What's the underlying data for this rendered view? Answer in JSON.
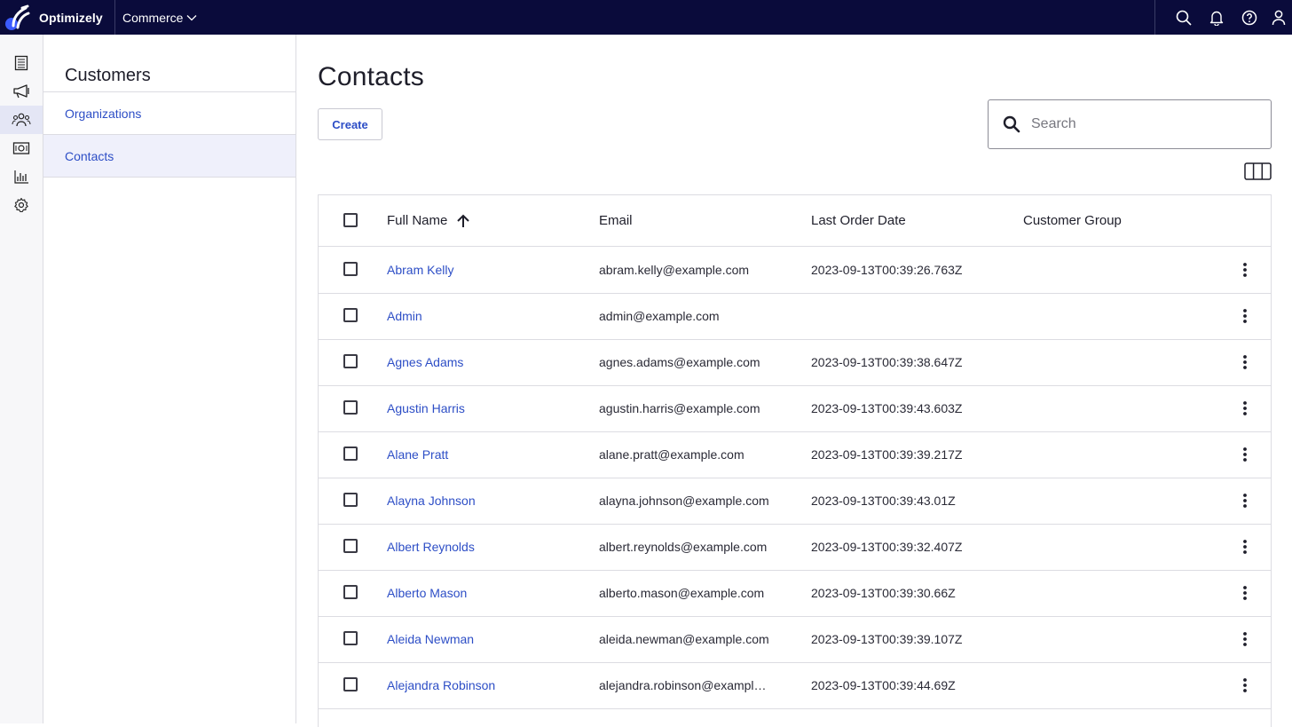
{
  "header": {
    "brand": "Optimizely",
    "product": "Commerce"
  },
  "rail": {
    "items": [
      {
        "icon": "catalog-book-icon"
      },
      {
        "icon": "marketing-megaphone-icon"
      },
      {
        "icon": "customers-group-icon",
        "active": true
      },
      {
        "icon": "orders-money-icon"
      },
      {
        "icon": "reports-chart-icon"
      },
      {
        "icon": "settings-gear-icon"
      }
    ]
  },
  "subnav": {
    "title": "Customers",
    "items": [
      {
        "label": "Organizations"
      },
      {
        "label": "Contacts"
      }
    ]
  },
  "main": {
    "title": "Contacts",
    "create_label": "Create",
    "search_placeholder": "Search"
  },
  "table": {
    "headers": {
      "full_name": "Full Name",
      "email": "Email",
      "last_order": "Last Order Date",
      "group": "Customer Group"
    },
    "rows": [
      {
        "name": "Abram Kelly",
        "email": "abram.kelly@example.com",
        "date": "2023-09-13T00:39:26.763Z",
        "group": ""
      },
      {
        "name": "Admin",
        "email": "admin@example.com",
        "date": "",
        "group": ""
      },
      {
        "name": "Agnes Adams",
        "email": "agnes.adams@example.com",
        "date": "2023-09-13T00:39:38.647Z",
        "group": ""
      },
      {
        "name": "Agustin Harris",
        "email": "agustin.harris@example.com",
        "date": "2023-09-13T00:39:43.603Z",
        "group": ""
      },
      {
        "name": "Alane Pratt",
        "email": "alane.pratt@example.com",
        "date": "2023-09-13T00:39:39.217Z",
        "group": ""
      },
      {
        "name": "Alayna Johnson",
        "email": "alayna.johnson@example.com",
        "date": "2023-09-13T00:39:43.01Z",
        "group": ""
      },
      {
        "name": "Albert Reynolds",
        "email": "albert.reynolds@example.com",
        "date": "2023-09-13T00:39:32.407Z",
        "group": ""
      },
      {
        "name": "Alberto Mason",
        "email": "alberto.mason@example.com",
        "date": "2023-09-13T00:39:30.66Z",
        "group": ""
      },
      {
        "name": "Aleida Newman",
        "email": "aleida.newman@example.com",
        "date": "2023-09-13T00:39:39.107Z",
        "group": ""
      },
      {
        "name": "Alejandra Robinson",
        "email": "alejandra.robinson@exampl…",
        "date": "2023-09-13T00:39:44.69Z",
        "group": ""
      }
    ]
  },
  "colors": {
    "topbar": "#0a0b3b",
    "link": "#2d4ec6",
    "accent": "#3b5bff"
  }
}
